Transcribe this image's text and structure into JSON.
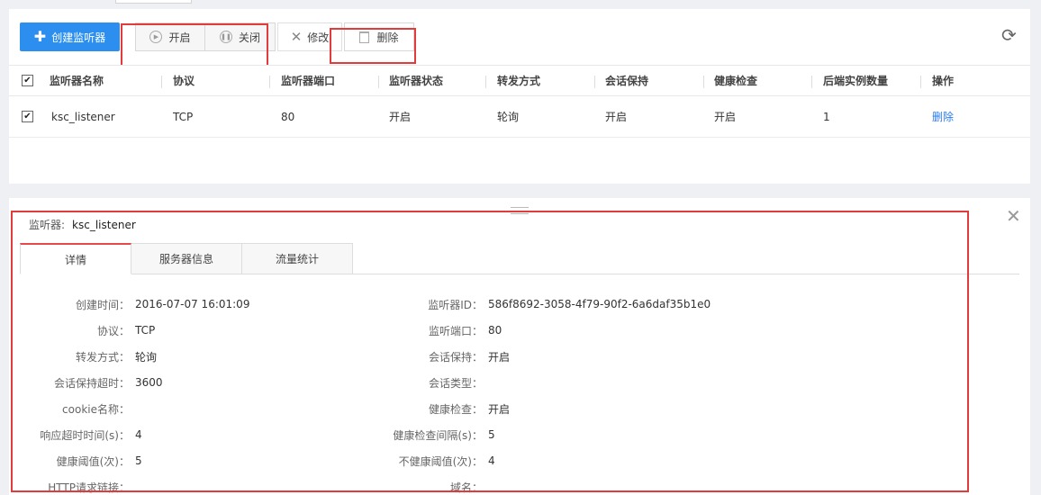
{
  "toolbar": {
    "create_label": "创建监听器",
    "start_label": "开启",
    "close_label": "关闭",
    "modify_label": "修改",
    "delete_label": "删除"
  },
  "table": {
    "headers": [
      "监听器名称",
      "协议",
      "监听器端口",
      "监听器状态",
      "转发方式",
      "会话保持",
      "健康检查",
      "后端实例数量",
      "操作"
    ],
    "rows": [
      {
        "name": "ksc_listener",
        "protocol": "TCP",
        "port": "80",
        "status": "开启",
        "forward": "轮询",
        "session": "开启",
        "health": "开启",
        "backend": "1",
        "action": "删除"
      }
    ]
  },
  "detail": {
    "title_key": "监听器:",
    "title_value": "ksc_listener",
    "tabs": [
      "详情",
      "服务器信息",
      "流量统计"
    ],
    "left": [
      {
        "k": "创建时间：",
        "v": "2016-07-07 16:01:09"
      },
      {
        "k": "协议：",
        "v": "TCP"
      },
      {
        "k": "转发方式：",
        "v": "轮询"
      },
      {
        "k": "会话保持超时：",
        "v": "3600"
      },
      {
        "k": "cookie名称：",
        "v": ""
      },
      {
        "k": "响应超时时间(s)：",
        "v": "4"
      },
      {
        "k": "健康阈值(次)：",
        "v": "5"
      },
      {
        "k": "HTTP请求链接：",
        "v": ""
      }
    ],
    "right": [
      {
        "k": "监听器ID：",
        "v": "586f8692-3058-4f79-90f2-6a6daf35b1e0"
      },
      {
        "k": "监听端口：",
        "v": "80"
      },
      {
        "k": "会话保持：",
        "v": "开启"
      },
      {
        "k": "会话类型：",
        "v": ""
      },
      {
        "k": "健康检查：",
        "v": "开启"
      },
      {
        "k": "健康检查间隔(s)：",
        "v": "5"
      },
      {
        "k": "不健康阈值(次)：",
        "v": "4"
      },
      {
        "k": "域名：",
        "v": ""
      }
    ]
  },
  "colors": {
    "primary": "#2c8ff0",
    "highlight": "#e23b3b",
    "link": "#2c7be5"
  },
  "icons": [
    "plus-icon",
    "play-icon",
    "pause-icon",
    "tools-icon",
    "trash-icon",
    "refresh-icon",
    "close-icon",
    "checkbox-icon",
    "drag-handle-icon"
  ]
}
